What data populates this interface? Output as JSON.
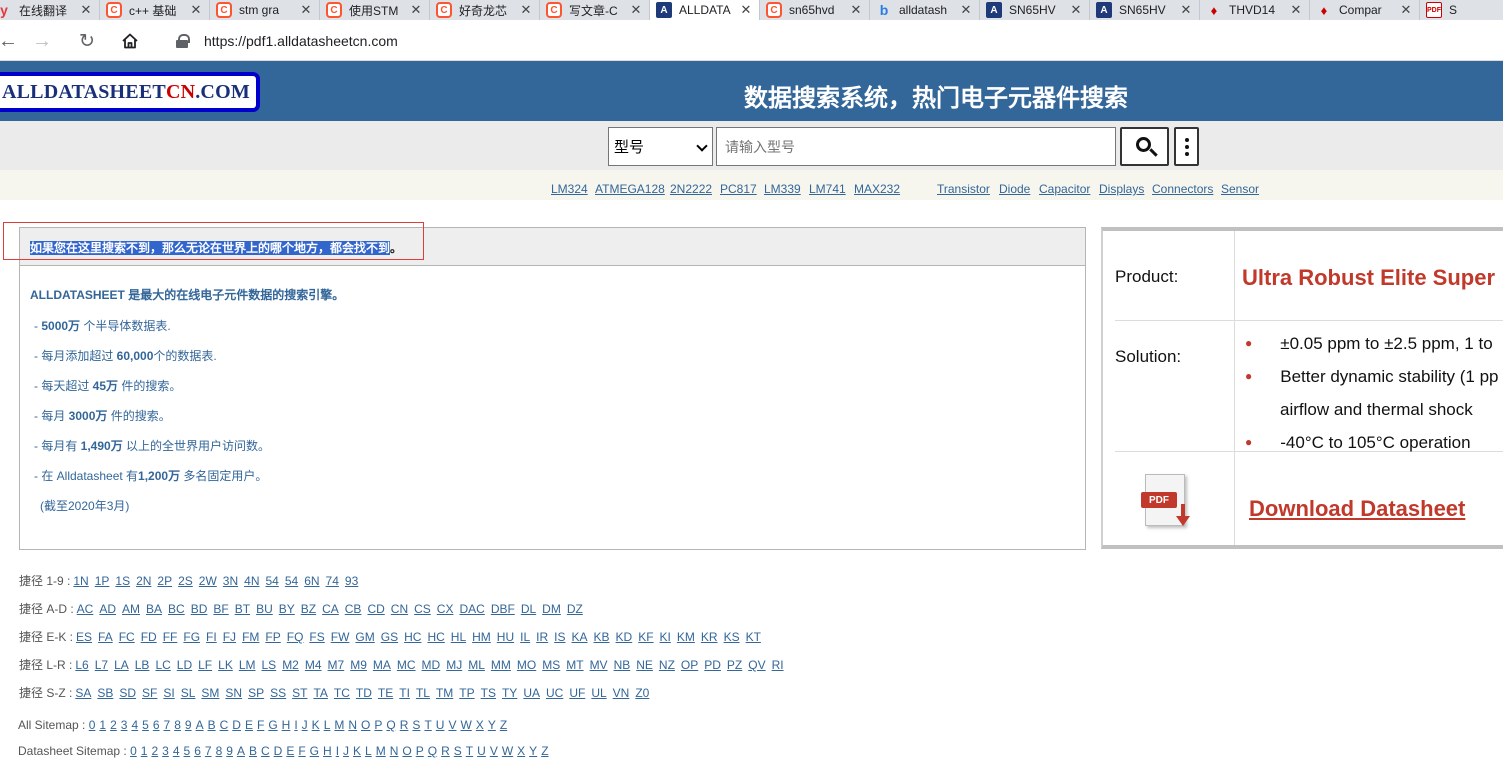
{
  "tabs": [
    {
      "icon": "youdao-icon",
      "glyph": "y",
      "cls": "yd",
      "title": "在线翻译"
    },
    {
      "icon": "csdn-icon",
      "glyph": "C",
      "cls": "csdn",
      "title": "c++ 基础"
    },
    {
      "icon": "csdn-icon",
      "glyph": "C",
      "cls": "csdn",
      "title": "stm gra"
    },
    {
      "icon": "csdn-icon",
      "glyph": "C",
      "cls": "csdn",
      "title": "使用STM"
    },
    {
      "icon": "csdn-icon",
      "glyph": "C",
      "cls": "csdn",
      "title": "好奇龙芯"
    },
    {
      "icon": "csdn-icon",
      "glyph": "C",
      "cls": "csdn",
      "title": "写文章-C"
    },
    {
      "icon": "alldatasheet-icon",
      "glyph": "A",
      "cls": "ads",
      "title": "ALLDATA",
      "active": true
    },
    {
      "icon": "csdn-icon",
      "glyph": "C",
      "cls": "csdn",
      "title": "sn65hvd"
    },
    {
      "icon": "bing-icon",
      "glyph": "b",
      "cls": "bing",
      "title": "alldatash"
    },
    {
      "icon": "alldatasheet-icon",
      "glyph": "A",
      "cls": "ads",
      "title": "SN65HV"
    },
    {
      "icon": "alldatasheet-icon",
      "glyph": "A",
      "cls": "ads",
      "title": "SN65HV"
    },
    {
      "icon": "ti-icon",
      "glyph": "♦",
      "cls": "ti",
      "title": "THVD14"
    },
    {
      "icon": "ti-icon",
      "glyph": "♦",
      "cls": "ti",
      "title": "Compar"
    },
    {
      "icon": "pdf-icon",
      "glyph": "PDF",
      "cls": "pdf",
      "title": "S"
    }
  ],
  "address": {
    "url": "https://pdf1.alldatasheetcn.com"
  },
  "site": {
    "logo_main": "ALLDATASHEET",
    "logo_cn": "CN",
    "logo_tail": ".COM",
    "slogan": "数据搜索系统，热门电子元器件搜索"
  },
  "search": {
    "category": "型号",
    "placeholder": "请输入型号"
  },
  "quick_parts": [
    "LM324",
    "ATMEGA128",
    "2N2222",
    "PC817",
    "LM339",
    "LM741",
    "MAX232"
  ],
  "quick_categories": [
    "Transistor",
    "Diode",
    "Capacitor",
    "Displays",
    "Connectors",
    "Sensor"
  ],
  "info": {
    "headline": "如果您在这里搜索不到，那么无论在世界上的哪个地方，都会找不到",
    "headline_end": "。",
    "title": "ALLDATASHEET 是最大的在线电子元件数据的搜索引擎。",
    "lines": [
      {
        "pre": "- ",
        "bold": "5000万",
        "post": " 个半导体数据表."
      },
      {
        "pre": "- 每月添加超过 ",
        "bold": "60,000",
        "post": "个的数据表."
      },
      {
        "pre": "- 每天超过 ",
        "bold": "45万",
        "post": " 件的搜索。"
      },
      {
        "pre": "- 每月 ",
        "bold": "3000万",
        "post": " 件的搜索。"
      },
      {
        "pre": "- 每月有 ",
        "bold": "1,490万",
        "post": " 以上的全世界用户访问数。"
      },
      {
        "pre": "- 在 Alldatasheet 有",
        "bold": "1,200万",
        "post": " 多名固定用户。"
      }
    ],
    "note": "(截至2020年3月)"
  },
  "ad": {
    "product_label": "Product:",
    "product": "Ultra Robust Elite Super",
    "solution_label": "Solution:",
    "bullets": [
      "±0.05 ppm to ±2.5 ppm, 1 to",
      "Better dynamic stability (1 pp",
      "-40°C to 105°C operation"
    ],
    "continuation": "airflow and thermal shock",
    "pdf_tag": "PDF",
    "download": "Download Datasheet"
  },
  "shortcuts": [
    {
      "label": "捷径 1-9 :",
      "links": [
        "1N",
        "1P",
        "1S",
        "2N",
        "2P",
        "2S",
        "2W",
        "3N",
        "4N",
        "54",
        "54",
        "6N",
        "74",
        "93"
      ]
    },
    {
      "label": "捷径 A-D :",
      "links": [
        "AC",
        "AD",
        "AM",
        "BA",
        "BC",
        "BD",
        "BF",
        "BT",
        "BU",
        "BY",
        "BZ",
        "CA",
        "CB",
        "CD",
        "CN",
        "CS",
        "CX",
        "DAC",
        "DBF",
        "DL",
        "DM",
        "DZ"
      ]
    },
    {
      "label": "捷径 E-K :",
      "links": [
        "ES",
        "FA",
        "FC",
        "FD",
        "FF",
        "FG",
        "FI",
        "FJ",
        "FM",
        "FP",
        "FQ",
        "FS",
        "FW",
        "GM",
        "GS",
        "HC",
        "HC",
        "HL",
        "HM",
        "HU",
        "IL",
        "IR",
        "IS",
        "KA",
        "KB",
        "KD",
        "KF",
        "KI",
        "KM",
        "KR",
        "KS",
        "KT"
      ]
    },
    {
      "label": "捷径 L-R :",
      "links": [
        "L6",
        "L7",
        "LA",
        "LB",
        "LC",
        "LD",
        "LF",
        "LK",
        "LM",
        "LS",
        "M2",
        "M4",
        "M7",
        "M9",
        "MA",
        "MC",
        "MD",
        "MJ",
        "ML",
        "MM",
        "MO",
        "MS",
        "MT",
        "MV",
        "NB",
        "NE",
        "NZ",
        "OP",
        "PD",
        "PZ",
        "QV",
        "RI"
      ]
    },
    {
      "label": "捷径 S-Z :",
      "links": [
        "SA",
        "SB",
        "SD",
        "SF",
        "SI",
        "SL",
        "SM",
        "SN",
        "SP",
        "SS",
        "ST",
        "TA",
        "TC",
        "TD",
        "TE",
        "TI",
        "TL",
        "TM",
        "TP",
        "TS",
        "TY",
        "UA",
        "UC",
        "UF",
        "UL",
        "VN",
        "Z0"
      ]
    }
  ],
  "sitemaps": [
    {
      "label": "All Sitemap : ",
      "links": [
        "0",
        "1",
        "2",
        "3",
        "4",
        "5",
        "6",
        "7",
        "8",
        "9",
        "A",
        "B",
        "C",
        "D",
        "E",
        "F",
        "G",
        "H",
        "I",
        "J",
        "K",
        "L",
        "M",
        "N",
        "O",
        "P",
        "Q",
        "R",
        "S",
        "T",
        "U",
        "V",
        "W",
        "X",
        "Y",
        "Z"
      ]
    },
    {
      "label": "Datasheet Sitemap : ",
      "links": [
        "0",
        "1",
        "2",
        "3",
        "4",
        "5",
        "6",
        "7",
        "8",
        "9",
        "A",
        "B",
        "C",
        "D",
        "E",
        "F",
        "G",
        "H",
        "I",
        "J",
        "K",
        "L",
        "M",
        "N",
        "O",
        "P",
        "Q",
        "R",
        "S",
        "T",
        "U",
        "V",
        "W",
        "X",
        "Y",
        "Z"
      ]
    }
  ],
  "colors": {
    "header": "#336699",
    "accent": "#c0392b",
    "link": "#336699",
    "selection": "#3366cc"
  }
}
